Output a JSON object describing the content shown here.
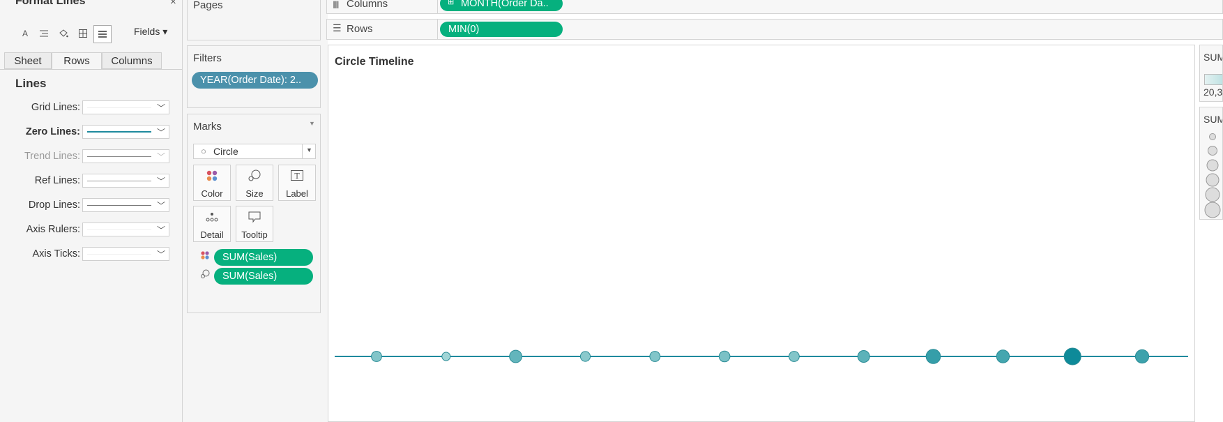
{
  "format_pane": {
    "title": "Format Lines",
    "close": "×",
    "fields_label": "Fields ▾",
    "tabs": [
      {
        "label": "Sheet",
        "active": false
      },
      {
        "label": "Rows",
        "active": true
      },
      {
        "label": "Columns",
        "active": false
      }
    ],
    "section_heading": "Lines",
    "line_rows": [
      {
        "label": "Grid Lines:",
        "sample": "none",
        "state": "normal"
      },
      {
        "label": "Zero Lines:",
        "sample": "solid-teal",
        "state": "bold"
      },
      {
        "label": "Trend Lines:",
        "sample": "solid-grey",
        "state": "disabled"
      },
      {
        "label": "Ref Lines:",
        "sample": "solid-grey",
        "state": "normal"
      },
      {
        "label": "Drop Lines:",
        "sample": "solid-grey",
        "state": "normal"
      },
      {
        "label": "Axis Rulers:",
        "sample": "none",
        "state": "normal"
      },
      {
        "label": "Axis Ticks:",
        "sample": "none",
        "state": "normal"
      }
    ]
  },
  "pages_card": {
    "title": "Pages"
  },
  "filters_card": {
    "title": "Filters",
    "pills": [
      "YEAR(Order Date): 2.."
    ]
  },
  "marks_card": {
    "title": "Marks",
    "mark_type": "Circle",
    "buttons": [
      "Color",
      "Size",
      "Label",
      "Detail",
      "Tooltip"
    ],
    "fields": [
      "SUM(Sales)",
      "SUM(Sales)"
    ]
  },
  "shelves": {
    "columns_label": "Columns",
    "columns_pill": "MONTH(Order Da..",
    "rows_label": "Rows",
    "rows_pill": "MIN(0)"
  },
  "view": {
    "title": "Circle Timeline",
    "colors": {
      "line": "#1f8a9e",
      "light": "#a9d9d9",
      "dark": "#0e8a99"
    },
    "chart_data": {
      "type": "scatter",
      "x": [
        1,
        2,
        3,
        4,
        5,
        6,
        7,
        8,
        9,
        10,
        11,
        12
      ],
      "y": [
        0,
        0,
        0,
        0,
        0,
        0,
        0,
        0,
        0,
        0,
        0,
        0
      ],
      "size_level": [
        0.35,
        0.15,
        0.55,
        0.3,
        0.35,
        0.4,
        0.35,
        0.5,
        0.75,
        0.6,
        1.0,
        0.65
      ],
      "color_level": [
        0.25,
        0.05,
        0.45,
        0.2,
        0.25,
        0.3,
        0.25,
        0.5,
        0.75,
        0.65,
        1.0,
        0.7
      ],
      "title": "Circle Timeline"
    }
  },
  "legends": {
    "color_title": "SUM",
    "color_value": "20,3",
    "size_title": "SUM"
  }
}
